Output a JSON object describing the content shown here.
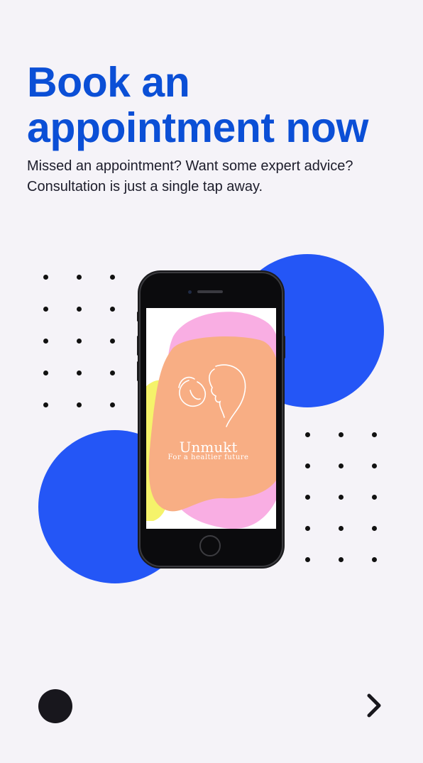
{
  "onboarding": {
    "title": "Book an appointment now",
    "subtitle": "Missed an appointment? Want some expert advice? Consultation is just a single tap away."
  },
  "app_preview": {
    "app_name": "Unmukt",
    "tagline": "For a healtier future",
    "icon": "mother-child-logo-icon"
  },
  "navigation": {
    "pager_icon": "pager-dot-icon",
    "next_icon": "chevron-right-icon"
  },
  "colors": {
    "title": "#0b4fd6",
    "blob": "#2456f6",
    "background": "#f5f3f8",
    "screen_orange": "#f8ae84",
    "screen_pink": "#f9aee3",
    "screen_yellow": "#f5f36a"
  }
}
